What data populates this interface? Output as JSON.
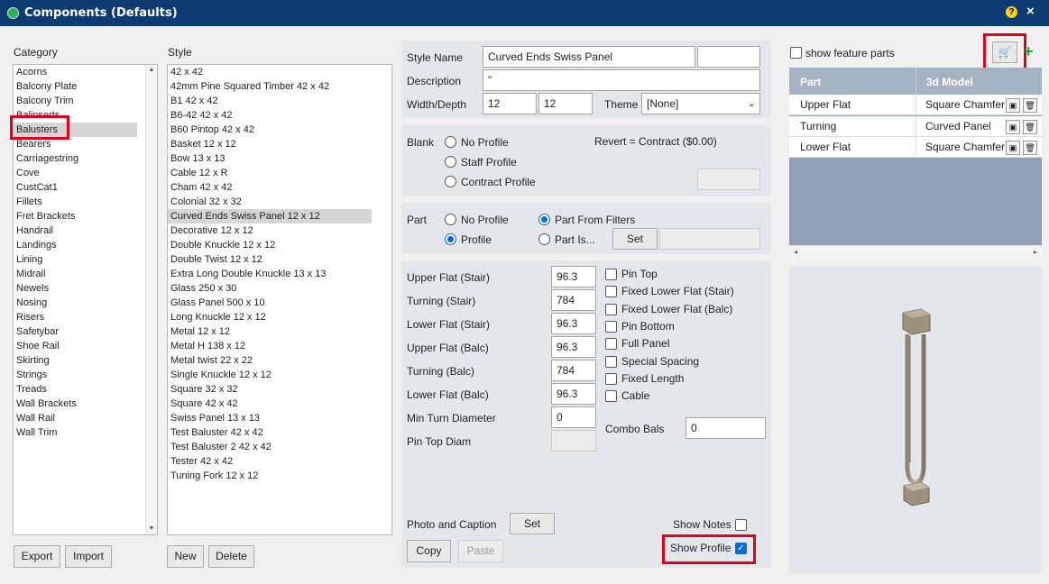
{
  "window": {
    "title": "Components (Defaults)"
  },
  "category": {
    "header": "Category",
    "items": [
      "Acorns",
      "Balcony Plate",
      "Balcony Trim",
      "Balinserts",
      "Balusters",
      "Bearers",
      "Carriagestring",
      "Cove",
      "CustCat1",
      "Fillets",
      "Fret Brackets",
      "Handrail",
      "Landings",
      "Lining",
      "Midrail",
      "Newels",
      "Nosing",
      "Risers",
      "Safetybar",
      "Shoe Rail",
      "Skirting",
      "Strings",
      "Treads",
      "Wall Brackets",
      "Wall Rail",
      "Wall Trim"
    ],
    "selected": "Balusters",
    "export_label": "Export",
    "import_label": "Import"
  },
  "style": {
    "header": "Style",
    "items": [
      "42 x 42",
      "42mm Pine Squared Timber 42 x 42",
      "B1 42 x 42",
      "B6-42 42 x 42",
      "B60 Pintop 42 x 42",
      "Basket 12 x 12",
      "Bow 13 x 13",
      "Cable 12 x R",
      "Cham 42 x 42",
      "Colonial 32 x 32",
      "Curved Ends Swiss Panel 12 x 12",
      "Decorative 12 x 12",
      "Double Knuckle 12 x 12",
      "Double Twist 12 x 12",
      "Extra Long Double Knuckle 13 x 13",
      "Glass 250 x 30",
      "Glass Panel 500 x 10",
      "Long Knuckle 12 x 12",
      "Metal 12 x 12",
      "Metal H 138 x 12",
      "Metal twist 22 x 22",
      "Single Knuckle 12 x 12",
      "Square 32 x 32",
      "Square 42 x 42",
      "Swiss Panel 13 x 13",
      "Test Baluster 42 x 42",
      "Test Baluster 2 42 x 42",
      "Tester 42 x 42",
      "Tuning Fork 12 x 12"
    ],
    "selected": "Curved Ends Swiss Panel 12 x 12",
    "new_label": "New",
    "delete_label": "Delete"
  },
  "details": {
    "style_name_label": "Style Name",
    "style_name_value": "Curved Ends Swiss Panel",
    "style_name_extra": "",
    "description_label": "Description",
    "description_value": "\"",
    "width_depth_label": "Width/Depth",
    "width_value": "12",
    "depth_value": "12",
    "theme_label": "Theme",
    "theme_value": "[None]"
  },
  "blank": {
    "label": "Blank",
    "options": [
      "No Profile",
      "Staff Profile",
      "Contract Profile"
    ],
    "revert_text": "Revert = Contract ($0.00)",
    "revert_value": ""
  },
  "part": {
    "label": "Part",
    "opt_no_profile": "No Profile",
    "opt_profile": "Profile",
    "opt_from_filters": "Part From Filters",
    "opt_part_is": "Part Is...",
    "set_label": "Set",
    "part_is_value": ""
  },
  "measurements": {
    "rows": [
      {
        "label": "Upper Flat (Stair)",
        "value": "96.3"
      },
      {
        "label": "Turning (Stair)",
        "value": "784"
      },
      {
        "label": "Lower Flat (Stair)",
        "value": "96.3"
      },
      {
        "label": "Upper Flat (Balc)",
        "value": "96.3"
      },
      {
        "label": "Turning (Balc)",
        "value": "784"
      },
      {
        "label": "Lower Flat (Balc)",
        "value": "96.3"
      },
      {
        "label": "Min Turn Diameter",
        "value": "0"
      },
      {
        "label": "Pin Top Diam",
        "value": ""
      }
    ],
    "checks": [
      "Pin Top",
      "Fixed Lower Flat (Stair)",
      "Fixed Lower Flat (Balc)",
      "Pin Bottom",
      "Full Panel",
      "Special Spacing",
      "Fixed Length",
      "Cable"
    ],
    "combo_bals_label": "Combo Bals",
    "combo_bals_value": "0"
  },
  "footer": {
    "photo_caption_label": "Photo and Caption",
    "set_label": "Set",
    "copy_label": "Copy",
    "paste_label": "Paste",
    "show_notes_label": "Show Notes",
    "show_profile_label": "Show Profile"
  },
  "parts_panel": {
    "show_feature_parts_label": "show feature parts",
    "columns": [
      "Part",
      "3d Model"
    ],
    "rows": [
      {
        "part": "Upper Flat",
        "model": "Square Chamfer"
      },
      {
        "part": "Turning",
        "model": "Curved Panel"
      },
      {
        "part": "Lower Flat",
        "model": "Square Chamfer"
      }
    ]
  },
  "icons": [
    "lock-icon",
    "help-icon",
    "close-icon",
    "cart-icon",
    "plus-icon",
    "image-icon",
    "trash-icon"
  ],
  "colors": {
    "titlebar": "#0f3b73",
    "highlight": "#e2001a",
    "accent": "#0b6bd8",
    "grid_header": "#a6b3c3"
  }
}
